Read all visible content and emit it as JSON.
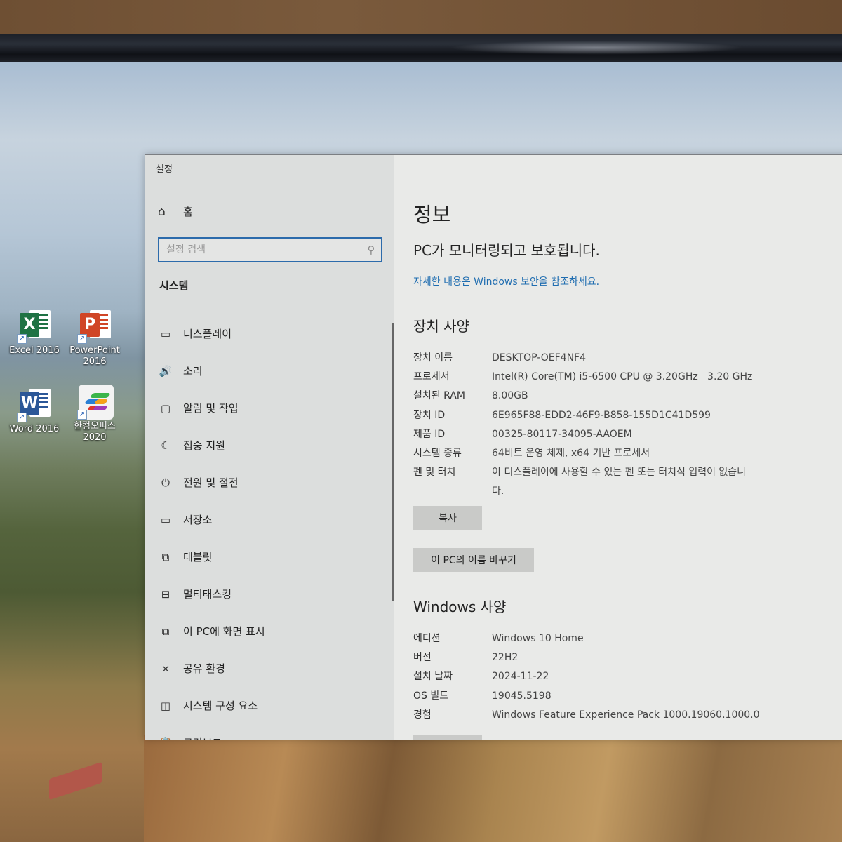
{
  "desktop": {
    "icons": [
      {
        "name": "excel",
        "label": "Excel 2016",
        "letter": "X",
        "color": "#1f7244"
      },
      {
        "name": "powerpoint",
        "label": "PowerPoint 2016",
        "letter": "P",
        "color": "#d04526"
      },
      {
        "name": "word",
        "label": "Word 2016",
        "letter": "W",
        "color": "#2b5797"
      },
      {
        "name": "hancom",
        "label": "한컴오피스 2020",
        "letter": "",
        "color": "#f3f3f3"
      }
    ]
  },
  "window": {
    "title": "설정",
    "minimize_glyph": "–",
    "maximize_glyph": ""
  },
  "sidebar": {
    "home_label": "홈",
    "home_icon": "⌂",
    "search_placeholder": "설정 검색",
    "search_icon": "⚲",
    "group_title": "시스템",
    "items": [
      {
        "label": "디스플레이",
        "icon": "▭"
      },
      {
        "label": "소리",
        "icon": "🔊"
      },
      {
        "label": "알림 및 작업",
        "icon": "▢"
      },
      {
        "label": "집중 지원",
        "icon": "☾"
      },
      {
        "label": "전원 및 절전",
        "icon": "⏻"
      },
      {
        "label": "저장소",
        "icon": "▭"
      },
      {
        "label": "태블릿",
        "icon": "⧉"
      },
      {
        "label": "멀티태스킹",
        "icon": "⊟"
      },
      {
        "label": "이 PC에 화면 표시",
        "icon": "⧉"
      },
      {
        "label": "공유 환경",
        "icon": "⨯"
      },
      {
        "label": "시스템 구성 요소",
        "icon": "◫"
      },
      {
        "label": "클립보드",
        "icon": "📋"
      }
    ]
  },
  "content": {
    "page_title": "정보",
    "protection_status": "PC가 모니터링되고 보호됩니다.",
    "security_link": "자세한 내용은 Windows 보안을 참조하세요.",
    "device_specs": {
      "title": "장치 사양",
      "rows": [
        {
          "key": "장치 이름",
          "value": "DESKTOP-OEF4NF4"
        },
        {
          "key": "프로세서",
          "value": "Intel(R) Core(TM) i5-6500 CPU @ 3.20GHz   3.20 GHz"
        },
        {
          "key": "설치된 RAM",
          "value": "8.00GB"
        },
        {
          "key": "장치 ID",
          "value": "6E965F88-EDD2-46F9-B858-155D1C41D599"
        },
        {
          "key": "제품 ID",
          "value": "00325-80117-34095-AAOEM"
        },
        {
          "key": "시스템 종류",
          "value": "64비트 운영 체제, x64 기반 프로세서"
        },
        {
          "key": "펜 및 터치",
          "value": "이 디스플레이에 사용할 수 있는 펜 또는 터치식 입력이 없습니다."
        }
      ],
      "copy_button": "복사",
      "rename_button": "이 PC의 이름 바꾸기"
    },
    "windows_specs": {
      "title": "Windows 사양",
      "rows": [
        {
          "key": "에디션",
          "value": "Windows 10 Home"
        },
        {
          "key": "버전",
          "value": "22H2"
        },
        {
          "key": "설치 날짜",
          "value": "2024-11-22"
        },
        {
          "key": "OS 빌드",
          "value": "19045.5198"
        },
        {
          "key": "경험",
          "value": "Windows Feature Experience Pack 1000.19060.1000.0"
        }
      ]
    }
  }
}
